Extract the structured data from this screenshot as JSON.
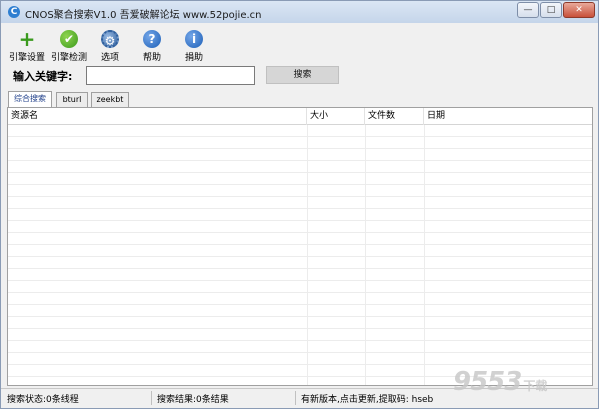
{
  "window": {
    "title": "CNOS聚合搜索V1.0  吾爱破解论坛 www.52pojie.cn",
    "app_icon": "cnos-app-icon",
    "controls": {
      "minimize": "—",
      "maximize": "□",
      "close": "✕"
    }
  },
  "toolbar": {
    "items": [
      {
        "label": "引擎设置",
        "icon": "plus-icon",
        "glyph": "+"
      },
      {
        "label": "引擎检测",
        "icon": "check-icon",
        "glyph": "✔"
      },
      {
        "label": "选项",
        "icon": "gear-icon",
        "glyph": "⚙"
      },
      {
        "label": "帮助",
        "icon": "help-icon",
        "glyph": "?"
      },
      {
        "label": "捐助",
        "icon": "info-icon",
        "glyph": "i"
      }
    ]
  },
  "search": {
    "label": "输入关键字:",
    "value": "",
    "button": "搜索"
  },
  "tabs": [
    {
      "label": "综合搜索",
      "active": true
    },
    {
      "label": "bturl",
      "active": false
    },
    {
      "label": "zeekbt",
      "active": false
    }
  ],
  "table": {
    "columns": [
      "资源名",
      "大小",
      "文件数",
      "日期"
    ],
    "rows": []
  },
  "status": {
    "search_state": "搜索状态:0条线程",
    "search_result": "搜索结果:0条结果",
    "update_notice": "有新版本,点击更新,提取码: hseb"
  },
  "watermark": {
    "big": "9553",
    "small": "下载"
  }
}
